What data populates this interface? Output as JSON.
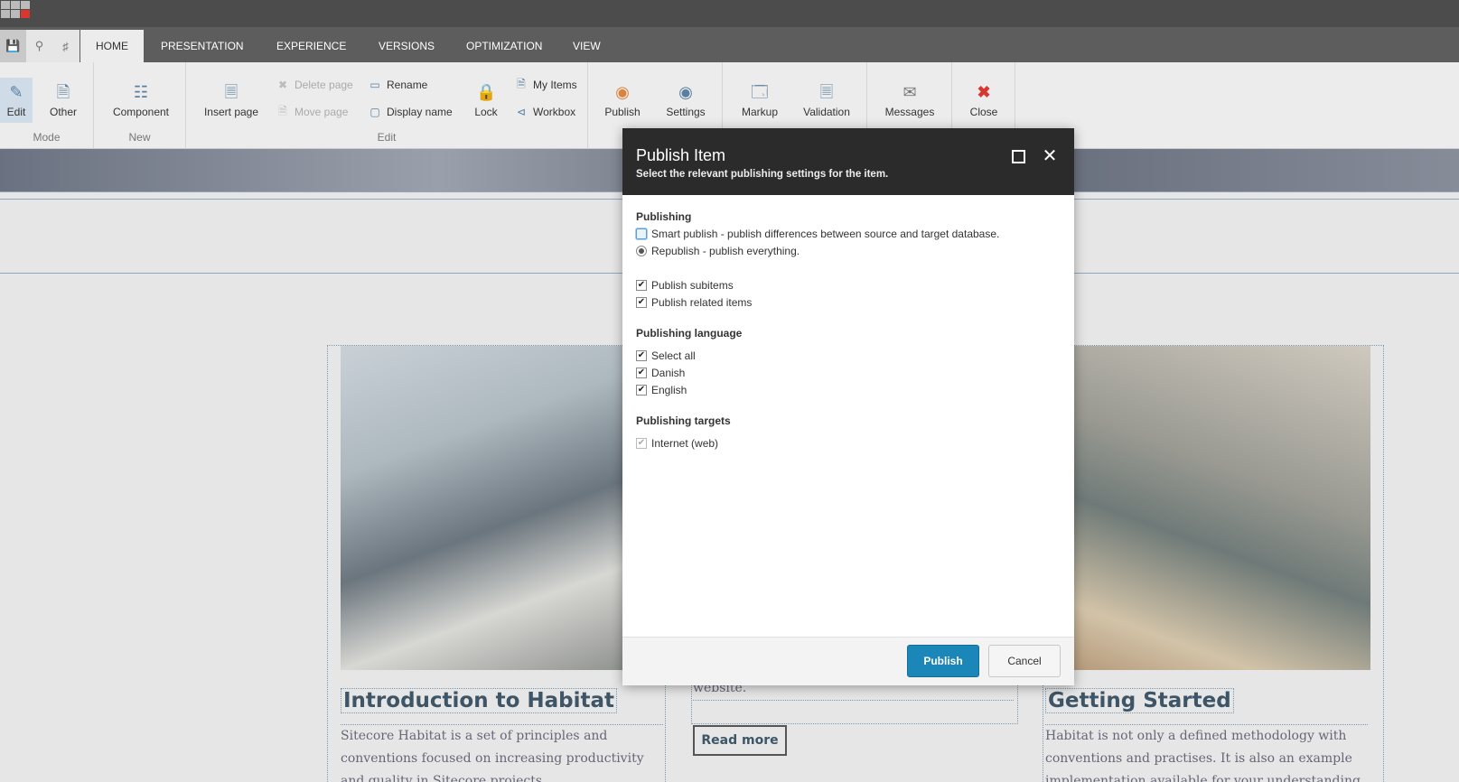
{
  "tabs": [
    "HOME",
    "PRESENTATION",
    "EXPERIENCE",
    "VERSIONS",
    "OPTIMIZATION",
    "VIEW"
  ],
  "active_tab": "HOME",
  "quick_access": [
    "save-icon",
    "search-icon",
    "tree-icon"
  ],
  "ribbon": {
    "mode": {
      "label": "Mode",
      "edit": "Edit",
      "other": "Other"
    },
    "new": {
      "label": "New",
      "component": "Component"
    },
    "edit": {
      "label": "Edit",
      "insert_page": "Insert page",
      "delete_page": "Delete page",
      "move_page": "Move page",
      "rename": "Rename",
      "display_name": "Display name",
      "lock": "Lock",
      "my_items": "My Items",
      "workbox": "Workbox"
    },
    "publish": "Publish",
    "settings": "Settings",
    "markup": "Markup",
    "validation": "Validation",
    "messages": "Messages",
    "close": "Close"
  },
  "dialog": {
    "title": "Publish Item",
    "subtitle": "Select the relevant publishing settings for the item.",
    "publishing_heading": "Publishing",
    "smart_publish": "Smart publish - publish differences between source and target database.",
    "republish": "Republish - publish everything.",
    "publish_subitems": "Publish subitems",
    "publish_related": "Publish related items",
    "language_heading": "Publishing language",
    "languages": [
      "Select all",
      "Danish",
      "English"
    ],
    "targets_heading": "Publishing targets",
    "targets": [
      "Internet (web)"
    ],
    "publish_button": "Publish",
    "cancel_button": "Cancel"
  },
  "page": {
    "card1": {
      "title": "Introduction to Habitat",
      "text": "Sitecore Habitat is a set of principles and conventions focused on increasing productivity and quality in Sitecore projects."
    },
    "card2": {
      "text": "website.",
      "read_more": "Read more"
    },
    "card3": {
      "title": "Getting Started",
      "text": "Habitat is not only a defined methodology with conventions and practises. It is also an example implementation available for your understanding."
    }
  }
}
